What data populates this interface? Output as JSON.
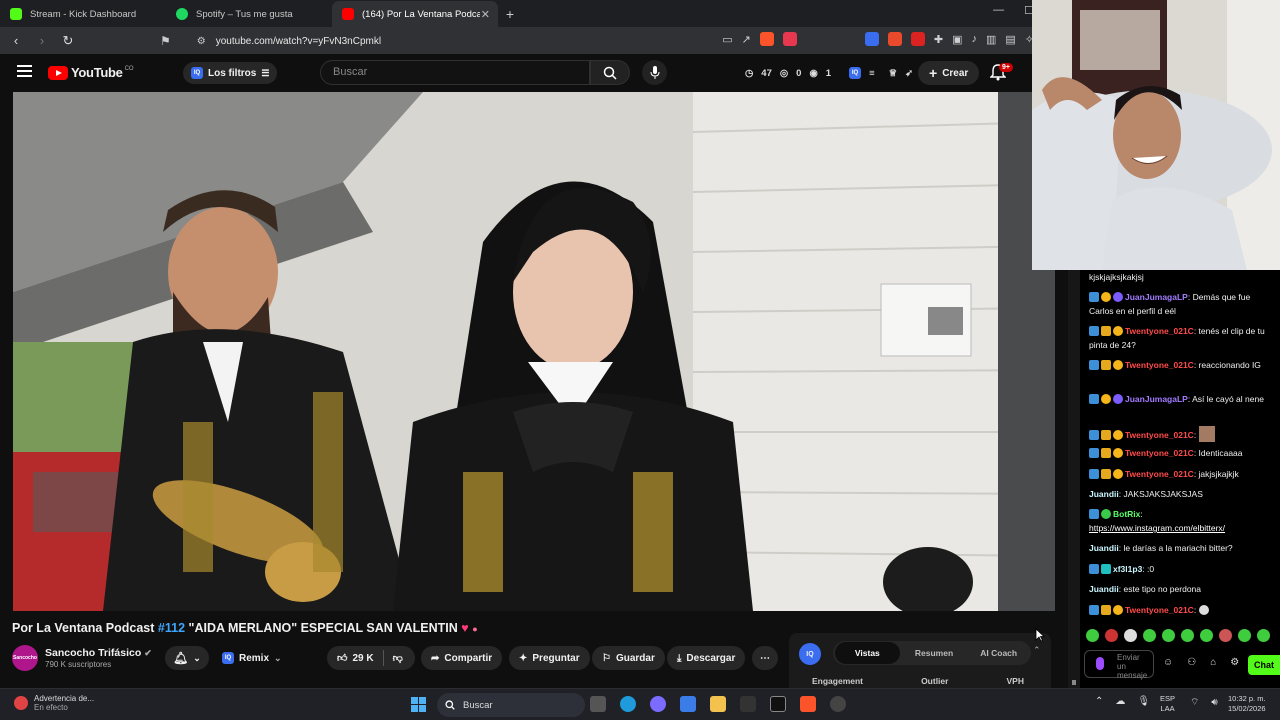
{
  "browser": {
    "tabs": [
      {
        "label": "Stream - Kick Dashboard",
        "color": "#53fc18"
      },
      {
        "label": "Spotify – Tus me gusta",
        "color": "#1ed760"
      },
      {
        "label": "(164) Por La Ventana Podcast",
        "color": "#ff0000",
        "active": true
      }
    ],
    "new_tab": "+",
    "url": "youtube.com/watch?v=yFvN3nCpmkl"
  },
  "youtube": {
    "logo_word": "YouTube",
    "country": "CO",
    "filters_label": "Los filtros",
    "search_placeholder": "Buscar",
    "stats": {
      "a": "47",
      "b": "0",
      "c": "1"
    },
    "create_label": "Crear",
    "notif_badge": "9+"
  },
  "video": {
    "title_prefix": "Por La Ventana Podcast",
    "title_tag": "#112",
    "title_rest": "\"AIDA MERLANO\" ESPECIAL SAN VALENTIN",
    "channel_name": "Sancocho Trifásico",
    "channel_subs": "790 K suscriptores",
    "avatar_text": "Sancocho",
    "remix_label": "Remix",
    "likes": "29 K",
    "share_label": "Compartir",
    "ask_label": "Preguntar",
    "save_label": "Guardar",
    "download_label": "Descargar"
  },
  "panel": {
    "iq": "IQ",
    "tabs": [
      "Vistas",
      "Resumen",
      "AI Coach"
    ],
    "metrics": [
      "Engagement",
      "Outlier",
      "VPH"
    ]
  },
  "chat": {
    "lines": [
      {
        "user": "",
        "text": "kjskjajksjkakjsj"
      },
      {
        "user": "JuanJumagaLP",
        "cls": "u1",
        "text": "Demás que fue Carlos en el perfil d eél"
      },
      {
        "user": "Twentyone_021C",
        "cls": "u2",
        "text": "tenés el clip de tu pinta de 24?"
      },
      {
        "user": "Twentyone_021C",
        "cls": "u2",
        "text": "reaccionando IG"
      },
      {
        "user": "JuanJumagaLP",
        "cls": "u1",
        "text": "Así le cayó al nene"
      },
      {
        "user": "Twentyone_021C",
        "cls": "u2",
        "text": ""
      },
      {
        "user": "Twentyone_021C",
        "cls": "u2",
        "text": "Identicaaaa"
      },
      {
        "user": "Twentyone_021C",
        "cls": "u2",
        "text": "jakjsjkajkjk"
      },
      {
        "user": "Juandii",
        "cls": "u4",
        "text": "JAKSJAKSJAKSJAS"
      },
      {
        "user": "BotRix",
        "cls": "u3",
        "text": "https://www.instagram.com/elbitterx/"
      },
      {
        "user": "Juandii",
        "cls": "u4",
        "text": "le darías a la mariachi bitter?"
      },
      {
        "user": "xf3l1p3",
        "cls": "u4",
        "text": ":0"
      },
      {
        "user": "Juandii",
        "cls": "u4",
        "text": "este tipo no perdona"
      },
      {
        "user": "Twentyone_021C",
        "cls": "u2",
        "text": ""
      }
    ],
    "input_placeholder": "Enviar un mensaje",
    "send_label": "Chat"
  },
  "taskbar": {
    "notice_title": "Advertencia de...",
    "notice_sub": "En efecto",
    "search_label": "Buscar",
    "lang_top": "ESP",
    "lang_bottom": "LAA",
    "time": "10:32 p. m.",
    "date": "15/02/2026"
  }
}
